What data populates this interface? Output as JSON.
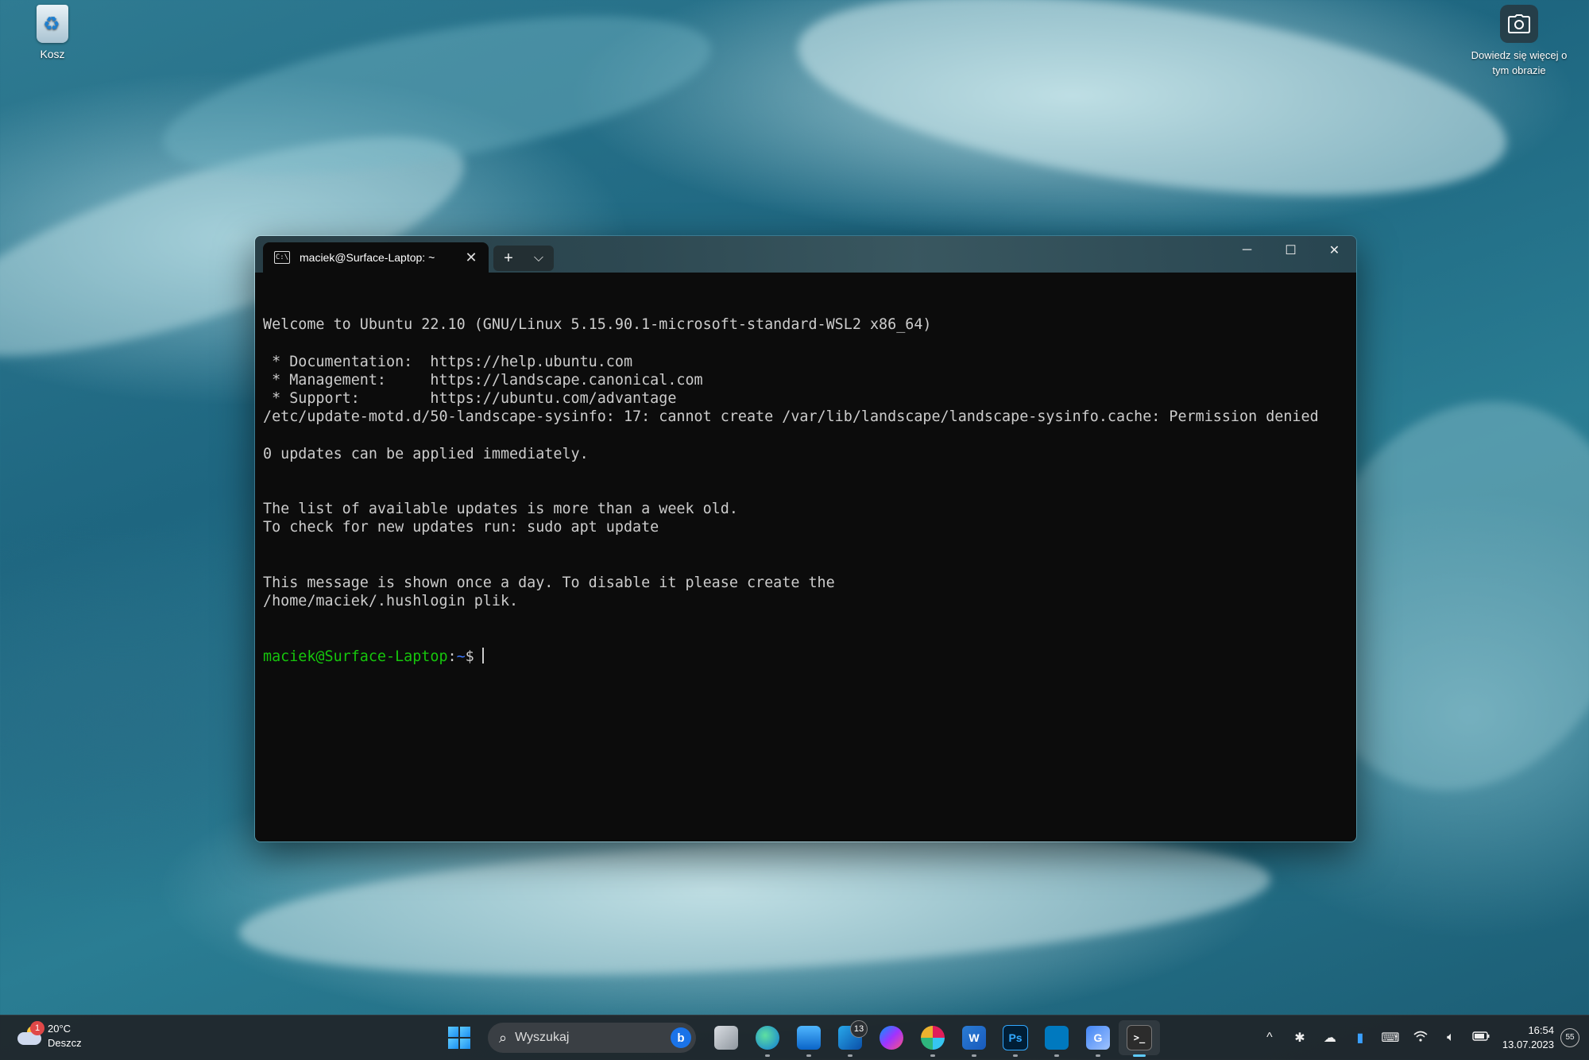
{
  "desktop": {
    "recycle_bin_label": "Kosz",
    "spotlight_label": "Dowiedz się więcej o tym obrazie"
  },
  "window": {
    "tab_title": "maciek@Surface-Laptop: ~",
    "tab_icon": "terminal-icon",
    "new_tab_glyph": "+",
    "dropdown_glyph": "⌵",
    "minimize_glyph": "─",
    "maximize_glyph": "☐",
    "close_glyph": "✕"
  },
  "terminal": {
    "lines": [
      "Welcome to Ubuntu 22.10 (GNU/Linux 5.15.90.1-microsoft-standard-WSL2 x86_64)",
      "",
      " * Documentation:  https://help.ubuntu.com",
      " * Management:     https://landscape.canonical.com",
      " * Support:        https://ubuntu.com/advantage",
      "/etc/update-motd.d/50-landscape-sysinfo: 17: cannot create /var/lib/landscape/landscape-sysinfo.cache: Permission denied",
      "",
      "0 updates can be applied immediately.",
      "",
      "",
      "The list of available updates is more than a week old.",
      "To check for new updates run: sudo apt update",
      "",
      "",
      "This message is shown once a day. To disable it please create the",
      "/home/maciek/.hushlogin plik."
    ],
    "prompt_user": "maciek@Surface-Laptop",
    "prompt_sep": ":",
    "prompt_path": "~",
    "prompt_symbol": "$",
    "colors": {
      "background": "#0c0c0c",
      "text": "#cccccc",
      "user": "#16c60c",
      "path": "#3b78ff"
    }
  },
  "taskbar": {
    "weather": {
      "temp": "20°C",
      "condition": "Deszcz",
      "badge": "1"
    },
    "search_placeholder": "Wyszukaj",
    "bing_label": "b",
    "apps": [
      {
        "name": "task-view-icon",
        "label": ""
      },
      {
        "name": "edge-icon",
        "label": ""
      },
      {
        "name": "mail-icon",
        "label": ""
      },
      {
        "name": "outlook-icon",
        "label": "",
        "badge": "13"
      },
      {
        "name": "messenger-icon",
        "label": ""
      },
      {
        "name": "slack-icon",
        "label": ""
      },
      {
        "name": "word-icon",
        "label": "W"
      },
      {
        "name": "photoshop-icon",
        "label": "Ps"
      },
      {
        "name": "trello-icon",
        "label": ""
      },
      {
        "name": "translate-icon",
        "label": "G"
      },
      {
        "name": "terminal-app-icon",
        "label": ">_"
      }
    ],
    "tray": {
      "chevron": "^",
      "time": "16:54",
      "date": "13.07.2023",
      "notifications": "55"
    }
  }
}
